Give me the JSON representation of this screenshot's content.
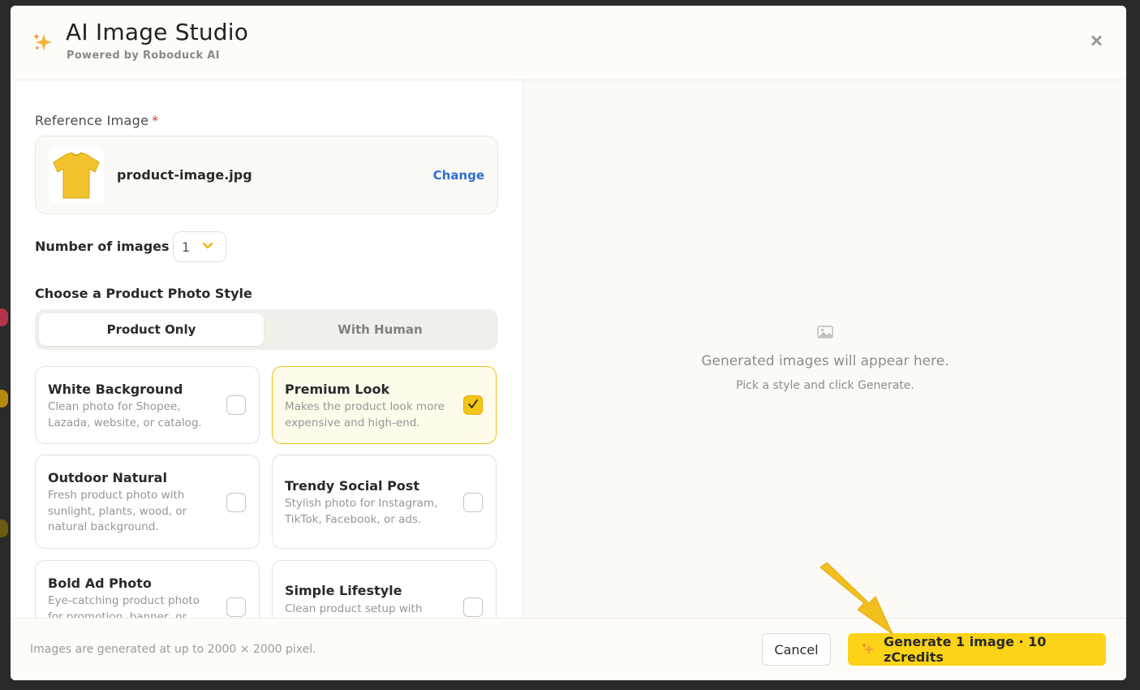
{
  "header": {
    "title": "AI Image Studio",
    "subtitle": "Powered by Roboduck AI",
    "icon": "sparkle-icon",
    "close_icon": "close-icon"
  },
  "reference": {
    "label": "Reference Image",
    "required_mark": "*",
    "filename": "product-image.jpg",
    "change_label": "Change",
    "thumbnail": "yellow-tshirt"
  },
  "count": {
    "label": "Number of images",
    "value": "1"
  },
  "style": {
    "heading": "Choose a Product Photo Style",
    "tabs": [
      {
        "label": "Product Only",
        "active": true
      },
      {
        "label": "With Human",
        "active": false
      }
    ],
    "cards": [
      {
        "name": "White Background",
        "desc": "Clean photo for Shopee, Lazada, website, or catalog.",
        "checked": false
      },
      {
        "name": "Premium Look",
        "desc": "Makes the product look more expensive and high-end.",
        "checked": true
      },
      {
        "name": "Outdoor Natural",
        "desc": "Fresh product photo with sunlight, plants, wood, or natural background.",
        "checked": false
      },
      {
        "name": "Trendy Social Post",
        "desc": "Stylish photo for Instagram, TikTok, Facebook, or ads.",
        "checked": false
      },
      {
        "name": "Bold Ad Photo",
        "desc": "Eye-catching product photo for promotion, banner, or",
        "checked": false
      },
      {
        "name": "Simple Lifestyle",
        "desc": "Clean product setup with simple props around it",
        "checked": false
      }
    ]
  },
  "preview": {
    "empty_title": "Generated images will appear here.",
    "empty_sub": "Pick a style and click Generate.",
    "icon": "image-icon"
  },
  "footer": {
    "note": "Images are generated at up to 2000 × 2000 pixel.",
    "cancel_label": "Cancel",
    "generate_label": "Generate 1 image · 10 zCredits"
  },
  "colors": {
    "accent": "#fcd316",
    "link": "#2f6ecf",
    "required": "#d43b3b",
    "selected_bg": "#fffbea"
  }
}
